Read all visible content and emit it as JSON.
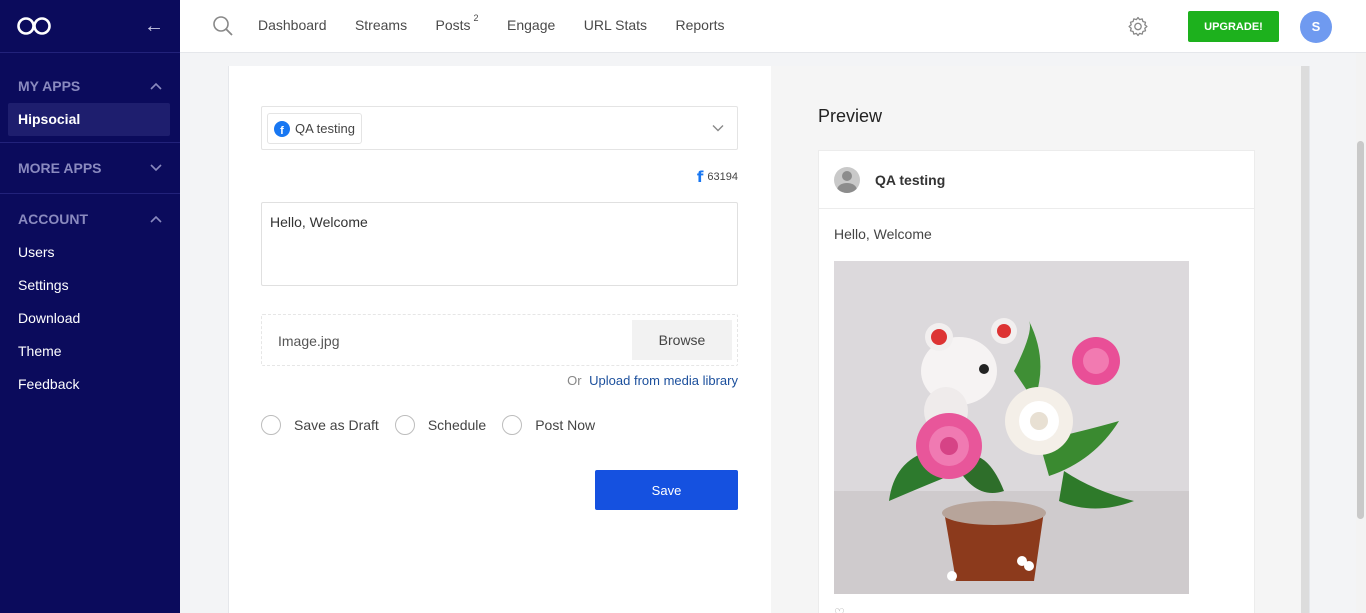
{
  "sidebar": {
    "sections": {
      "my_apps": {
        "title": "MY APPS",
        "items": [
          "Hipsocial"
        ]
      },
      "more_apps": {
        "title": "MORE APPS"
      },
      "account": {
        "title": "ACCOUNT",
        "items": [
          "Users",
          "Settings",
          "Download",
          "Theme",
          "Feedback"
        ]
      }
    }
  },
  "topnav": {
    "items": [
      "Dashboard",
      "Streams",
      "Posts",
      "Engage",
      "URL Stats",
      "Reports"
    ],
    "posts_badge": "2",
    "upgrade_label": "UPGRADE!",
    "avatar_initial": "S"
  },
  "composer": {
    "account_name": "QA testing",
    "char_count": "63194",
    "message": "Hello, Welcome",
    "file_name": "Image.jpg",
    "browse_label": "Browse",
    "or_label": "Or",
    "media_link_label": "Upload from media library",
    "options": [
      "Save as Draft",
      "Schedule",
      "Post Now"
    ],
    "save_label": "Save"
  },
  "preview": {
    "title": "Preview",
    "account_name": "QA testing",
    "message": "Hello, Welcome"
  },
  "colors": {
    "sidebar": "#0b0b5c",
    "upgrade": "#1db11d",
    "save": "#1551e0",
    "facebook": "#1877f2"
  }
}
